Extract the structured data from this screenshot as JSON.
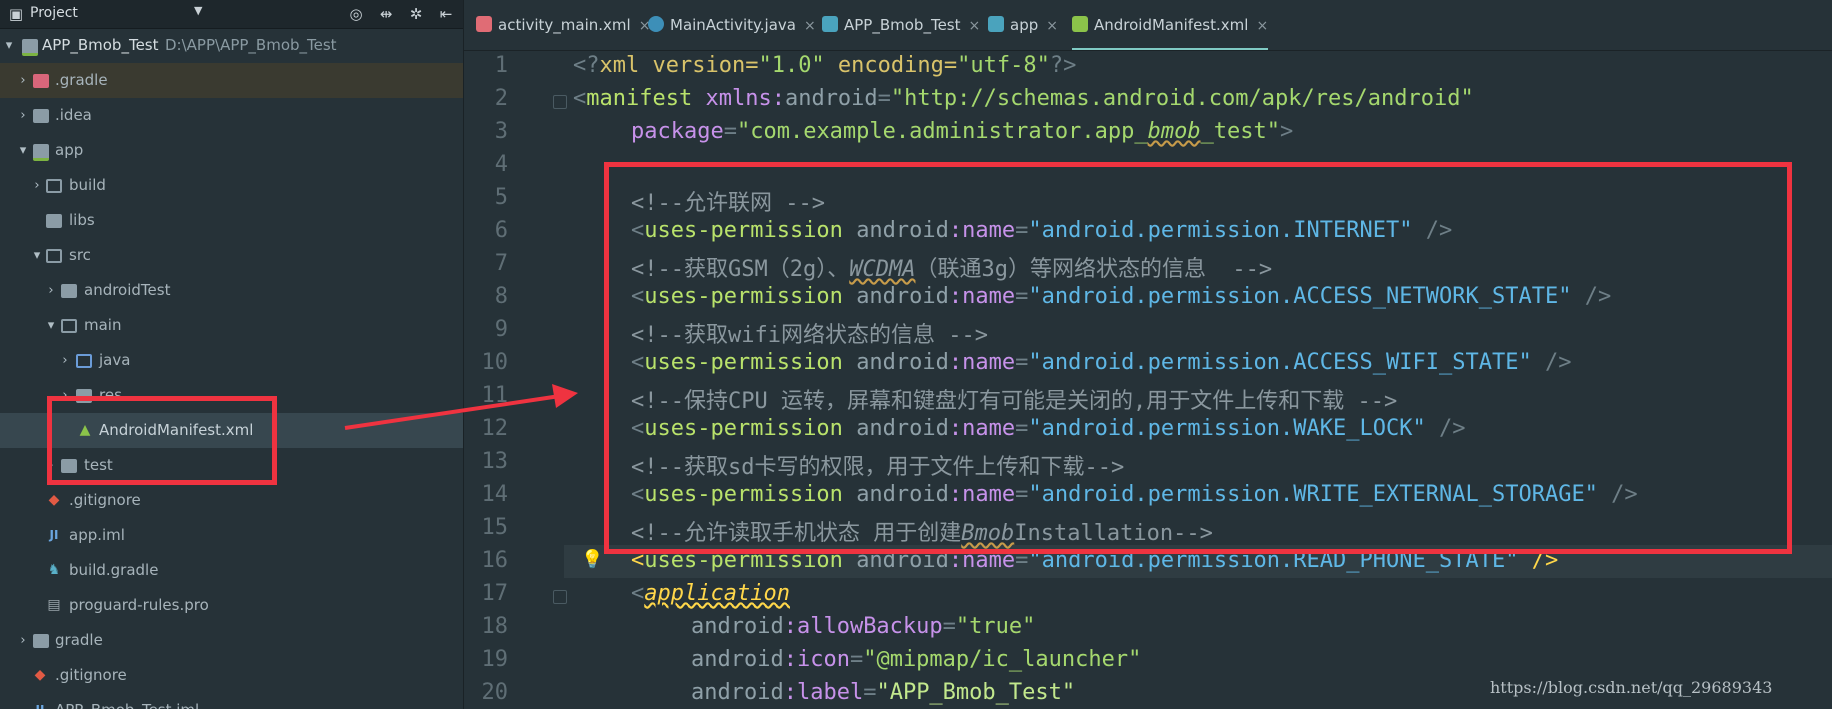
{
  "project_panel": {
    "title": "Project",
    "dropdown_icon": "triangle-down",
    "header_icons": [
      "target-icon",
      "collapse-icon",
      "gear-icon",
      "hide-icon"
    ],
    "items": [
      {
        "label": "APP_Bmob_Test",
        "path": "D:\\APP\\APP_Bmob_Test",
        "icon": "module-icon",
        "chev": "▾"
      },
      {
        "label": ".gradle",
        "icon": "folder-icon",
        "chev": "›"
      },
      {
        "label": ".idea",
        "icon": "folder-icon",
        "chev": "›"
      },
      {
        "label": "app",
        "icon": "folder-icon",
        "chev": "▾"
      },
      {
        "label": "build",
        "icon": "folder-icon",
        "chev": "›"
      },
      {
        "label": "libs",
        "icon": "folder-icon",
        "chev": ""
      },
      {
        "label": "src",
        "icon": "folder-icon",
        "chev": "▾"
      },
      {
        "label": "androidTest",
        "icon": "folder-icon",
        "chev": "›"
      },
      {
        "label": "main",
        "icon": "folder-icon",
        "chev": "▾"
      },
      {
        "label": "java",
        "icon": "folder-icon",
        "chev": "›"
      },
      {
        "label": "res",
        "icon": "folder-icon",
        "chev": "›"
      },
      {
        "label": "AndroidManifest.xml",
        "icon": "android-icon",
        "chev": ""
      },
      {
        "label": "test",
        "icon": "folder-icon",
        "chev": "›"
      },
      {
        "label": ".gitignore",
        "icon": "git-icon",
        "chev": ""
      },
      {
        "label": "app.iml",
        "icon": "iml-icon",
        "chev": ""
      },
      {
        "label": "build.gradle",
        "icon": "gradle-icon",
        "chev": ""
      },
      {
        "label": "proguard-rules.pro",
        "icon": "file-icon",
        "chev": ""
      },
      {
        "label": "gradle",
        "icon": "folder-icon",
        "chev": "›"
      },
      {
        "label": ".gitignore",
        "icon": "git-icon",
        "chev": ""
      },
      {
        "label": "APP_Bmob_Test.iml",
        "icon": "iml-icon",
        "chev": ""
      }
    ]
  },
  "tabs": [
    {
      "label": "activity_main.xml",
      "icon": "layout-icon",
      "close": "×"
    },
    {
      "label": "MainActivity.java",
      "icon": "class-icon",
      "close": "×"
    },
    {
      "label": "APP_Bmob_Test",
      "icon": "gradle-icon",
      "close": "×"
    },
    {
      "label": "app",
      "icon": "gradle-icon",
      "close": "×"
    },
    {
      "label": "AndroidManifest.xml",
      "icon": "android-icon",
      "close": "×"
    }
  ],
  "line_numbers": [
    "1",
    "2",
    "3",
    "4",
    "5",
    "6",
    "7",
    "8",
    "9",
    "10",
    "11",
    "12",
    "13",
    "14",
    "15",
    "16",
    "17",
    "18",
    "19",
    "20"
  ],
  "code": {
    "l1_a": "<?",
    "l1_b": "xml version=",
    "l1_c": "\"1.0\"",
    "l1_d": " encoding=",
    "l1_e": "\"utf-8\"",
    "l1_f": "?>",
    "l2_a": "<",
    "l2_b": "manifest ",
    "l2_c": "xmlns:",
    "l2_d": "android",
    "l2_e": "=",
    "l2_f": "\"http://schemas.android.com/apk/res/android\"",
    "l3_a": "package",
    "l3_b": "=",
    "l3_c": "\"com.example.administrator.app_",
    "l3_d": "bmob",
    "l3_e": "_test\"",
    "l3_f": ">",
    "l5": "<!--允许联网 -->",
    "l6_tag": "uses-permission",
    "l6_val": "\"android.permission.INTERNET\"",
    "l7_a": "<!--获取GSM（2g）、",
    "l7_b": "WCDMA",
    "l7_c": "（联通3g）等网络状态的信息  -->",
    "l8_val": "\"android.permission.ACCESS_NETWORK_STATE\"",
    "l9": "<!--获取wifi网络状态的信息 -->",
    "l10_val": "\"android.permission.ACCESS_WIFI_STATE\"",
    "l11": "<!--保持CPU 运转，屏幕和键盘灯有可能是关闭的,用于文件上传和下载 -->",
    "l12_val": "\"android.permission.WAKE_LOCK\"",
    "l13": "<!--获取sd卡写的权限，用于文件上传和下载-->",
    "l14_val": "\"android.permission.WRITE_EXTERNAL_STORAGE\"",
    "l15_a": "<!--允许读取手机状态 用于创建",
    "l15_b": "Bmob",
    "l15_c": "Installation-->",
    "l16_val": "\"android.permission.READ_PHONE_STATE\"",
    "l17": "application",
    "l18_a": "android",
    "l18_b": ":allowBackup",
    "l18_c": "=",
    "l18_d": "\"true\"",
    "l19_b": ":icon",
    "l19_d": "\"@mipmap/ic_launcher\"",
    "l20_b": ":label",
    "l20_d": "\"APP_Bmob_Test\"",
    "perm_ns": "android",
    "perm_attr": ":name",
    "perm_eq": "=",
    "perm_close": " />",
    "open": "<"
  },
  "watermark": "https://blog.csdn.net/qq_29689343",
  "colors": {
    "highlight_red": "#ef3340",
    "tag_green": "#b9e26b",
    "string_blue": "#5fb7e6"
  }
}
